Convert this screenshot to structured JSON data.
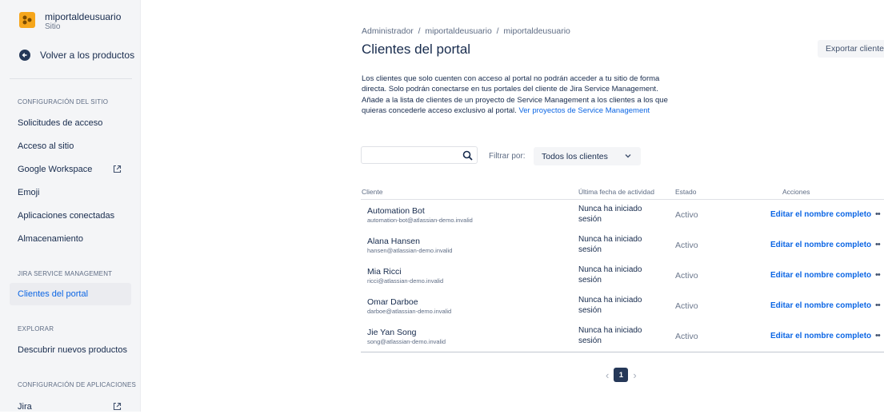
{
  "sidebar": {
    "site_name": "miportaldeusuario",
    "site_type": "Sitio",
    "back_label": "Volver a los productos",
    "sections": {
      "site_config": "CONFIGURACIÓN DEL SITIO",
      "jsm": "JIRA SERVICE MANAGEMENT",
      "explore": "EXPLORAR",
      "app_config": "CONFIGURACIÓN DE APLICACIONES"
    },
    "items": {
      "access_requests": "Solicitudes de acceso",
      "site_access": "Acceso al sitio",
      "google_workspace": "Google Workspace",
      "emoji": "Emoji",
      "connected_apps": "Aplicaciones conectadas",
      "storage": "Almacenamiento",
      "portal_customers": "Clientes del portal",
      "discover_products": "Descubrir nuevos productos",
      "jira": "Jira"
    }
  },
  "header": {
    "breadcrumb": "Administrador  /  miportaldeusuario  /  miportaldeusuario",
    "title": "Clientes del portal",
    "export_label": "Exportar cliente"
  },
  "description": {
    "text": "Los clientes que solo cuenten con acceso al portal no podrán acceder a tu sitio de forma directa. Solo podrán conectarse en tus portales del cliente de Jira Service Management. Añade a la lista de clientes de un proyecto de Service Management a los clientes a los que quieras concederle acceso exclusivo al portal. ",
    "link": "Ver proyectos de Service Management"
  },
  "filters": {
    "search_placeholder": "",
    "filter_label": "Filtrar por:",
    "filter_value": "Todos los clientes"
  },
  "table": {
    "headers": {
      "customer": "Cliente",
      "last_active": "Última fecha de actividad",
      "status": "Estado",
      "actions": "Acciones"
    },
    "rows": [
      {
        "name": "Automation Bot",
        "email": "automation-bot@atlassian-demo.invalid",
        "last": "Nunca ha iniciado sesión",
        "status": "Activo",
        "action": "Editar el nombre completo"
      },
      {
        "name": "Alana Hansen",
        "email": "hansen@atlassian-demo.invalid",
        "last": "Nunca ha iniciado sesión",
        "status": "Activo",
        "action": "Editar el nombre completo"
      },
      {
        "name": "Mia Ricci",
        "email": "ricci@atlassian-demo.invalid",
        "last": "Nunca ha iniciado sesión",
        "status": "Activo",
        "action": "Editar el nombre completo"
      },
      {
        "name": "Omar Darboe",
        "email": "darboe@atlassian-demo.invalid",
        "last": "Nunca ha iniciado sesión",
        "status": "Activo",
        "action": "Editar el nombre completo"
      },
      {
        "name": "Jie Yan Song",
        "email": "song@atlassian-demo.invalid",
        "last": "Nunca ha iniciado sesión",
        "status": "Activo",
        "action": "Editar el nombre completo"
      }
    ],
    "more_label": "••"
  },
  "pagination": {
    "prev": "‹",
    "current": "1",
    "next": "›"
  },
  "colors": {
    "link": "#0c66e4",
    "sidebar_bg": "#f4f5f7",
    "pager_active": "#253858"
  }
}
